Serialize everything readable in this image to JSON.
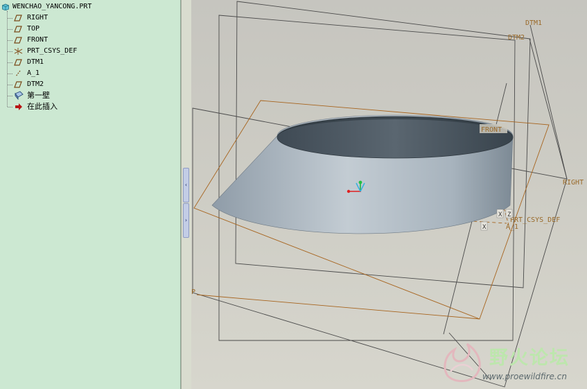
{
  "model_tree": {
    "root_label": "WENCHAO_YANCONG.PRT",
    "items": [
      {
        "label": "RIGHT",
        "icon": "datum-plane-icon"
      },
      {
        "label": "TOP",
        "icon": "datum-plane-icon"
      },
      {
        "label": "FRONT",
        "icon": "datum-plane-icon"
      },
      {
        "label": "PRT_CSYS_DEF",
        "icon": "coordinate-system-icon"
      },
      {
        "label": "DTM1",
        "icon": "datum-plane-icon"
      },
      {
        "label": "A_1",
        "icon": "datum-axis-icon"
      },
      {
        "label": "DTM2",
        "icon": "datum-plane-icon"
      },
      {
        "label": "第一壁",
        "icon": "wall-feature-icon"
      },
      {
        "label": "在此插入",
        "icon": "insert-here-arrow-icon"
      }
    ]
  },
  "splitter": {
    "collapse_label": "‹",
    "expand_label": "›"
  },
  "viewport": {
    "labels": {
      "dtm1": "DTM1",
      "dtm2": "DTM2",
      "front": "FRONT",
      "right": "RIGHT",
      "csys": "PRT_CSYS_DEF",
      "axis": "A_1",
      "top_plane": "P",
      "x1": "X",
      "z": "Z",
      "x2": "X"
    }
  },
  "watermark": {
    "title": "野火论坛",
    "url": "www.proewildfire.cn"
  },
  "colors": {
    "tree_bg": "#cce8d2",
    "datum_gray": "#4a4a4a",
    "datum_orange": "#a7641e",
    "surface": "#a7b5c0"
  }
}
